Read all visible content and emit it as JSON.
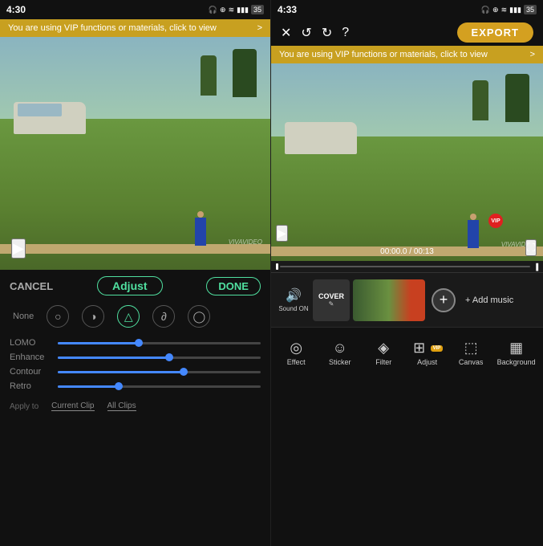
{
  "left": {
    "status": {
      "time": "4:30",
      "icons": "● ◯ ⊙ ≡ ▲ ◎"
    },
    "vip_banner": "You are using VIP functions or materials, click to view",
    "vip_chevron": ">",
    "controls": {
      "cancel_label": "CANCEL",
      "adjust_label": "Adjust",
      "done_label": "DONE"
    },
    "filter_icons": [
      "None",
      "○",
      "◑",
      "△",
      "∂"
    ],
    "sliders": [
      {
        "label": "LOMO",
        "fill_pct": 40
      },
      {
        "label": "Enhance",
        "fill_pct": 55
      },
      {
        "label": "Contour",
        "fill_pct": 62
      },
      {
        "label": "Retro",
        "fill_pct": 30
      }
    ],
    "apply": {
      "label": "Apply to",
      "current": "Current Clip",
      "all": "All Clips"
    },
    "watermark": "VIVAVIDEO"
  },
  "right": {
    "status": {
      "time": "4:33"
    },
    "toolbar": {
      "export_label": "EXPORT"
    },
    "vip_banner": "You are using VIP functions or materials, click to view",
    "vip_chevron": ">",
    "video": {
      "timestamp": "00:00.0 / 00:13",
      "watermark": "VIVAVIDEO"
    },
    "timeline": {
      "sound_label": "Sound ON",
      "cover_label": "COVER",
      "add_music_label": "+ Add music"
    },
    "bottom_tabs": [
      {
        "icon": "◎",
        "label": "Effect"
      },
      {
        "icon": "☺",
        "label": "Sticker"
      },
      {
        "icon": "◈",
        "label": "Filter"
      },
      {
        "icon": "⊞",
        "label": "Adjust",
        "has_vip": true
      },
      {
        "icon": "⬚",
        "label": "Canvas"
      },
      {
        "icon": "▦",
        "label": "Background"
      }
    ]
  }
}
